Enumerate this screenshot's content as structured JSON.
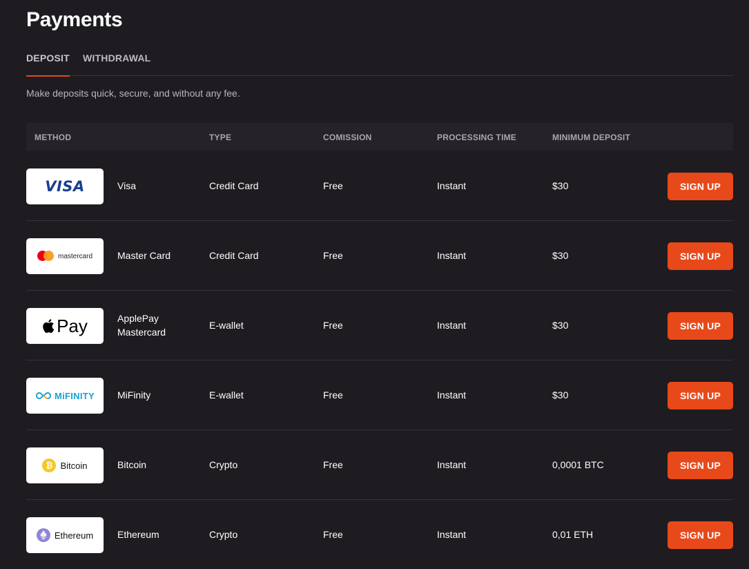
{
  "page": {
    "title": "Payments",
    "subtitle": "Make deposits quick, secure, and without any fee."
  },
  "tabs": [
    {
      "label": "DEPOSIT",
      "active": true
    },
    {
      "label": "WITHDRAWAL",
      "active": false
    }
  ],
  "table": {
    "headers": [
      "METHOD",
      "TYPE",
      "COMISSION",
      "PROCESSING TIME",
      "MINIMUM DEPOSIT"
    ],
    "rows": [
      {
        "logo": "visa",
        "logo_text": "VISA",
        "name": "Visa",
        "type": "Credit Card",
        "commission": "Free",
        "time": "Instant",
        "min": "$30",
        "button": "SIGN UP"
      },
      {
        "logo": "mastercard",
        "logo_text": "mastercard",
        "name": "Master Card",
        "type": "Credit Card",
        "commission": "Free",
        "time": "Instant",
        "min": "$30",
        "button": "SIGN UP"
      },
      {
        "logo": "applepay",
        "logo_text": "Pay",
        "name_line1": "ApplePay",
        "name_line2": "Mastercard",
        "type": "E-wallet",
        "commission": "Free",
        "time": "Instant",
        "min": "$30",
        "button": "SIGN UP"
      },
      {
        "logo": "mifinity",
        "logo_text": "MiFINITY",
        "name": "MiFinity",
        "type": "E-wallet",
        "commission": "Free",
        "time": "Instant",
        "min": "$30",
        "button": "SIGN UP"
      },
      {
        "logo": "bitcoin",
        "logo_text": "Bitcoin",
        "name": "Bitcoin",
        "type": "Crypto",
        "commission": "Free",
        "time": "Instant",
        "min": "0,0001 BTC",
        "button": "SIGN UP"
      },
      {
        "logo": "ethereum",
        "logo_text": "Ethereum",
        "name": "Ethereum",
        "type": "Crypto",
        "commission": "Free",
        "time": "Instant",
        "min": "0,01 ETH",
        "button": "SIGN UP"
      }
    ]
  },
  "colors": {
    "background": "#1e1c20",
    "accent": "#e8491a",
    "header_bg": "#252328",
    "muted_text": "#b9b7bc"
  },
  "icons": [
    "visa-logo-icon",
    "mastercard-logo-icon",
    "apple-logo-icon",
    "mifinity-logo-icon",
    "bitcoin-coin-icon",
    "ethereum-coin-icon"
  ]
}
